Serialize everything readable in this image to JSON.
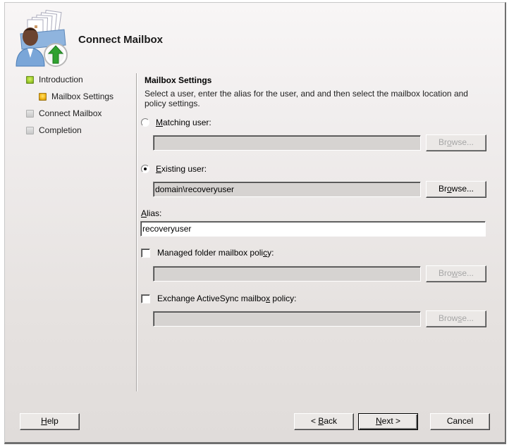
{
  "header": {
    "icon": "connect-mailbox-icon",
    "title": "Connect Mailbox"
  },
  "nav": {
    "items": [
      {
        "label": "Introduction",
        "status": "completed",
        "color": "#9fcb2a"
      },
      {
        "label": "Mailbox Settings",
        "status": "current",
        "color": "#f2b415"
      },
      {
        "label": "Connect Mailbox",
        "status": "pending",
        "color": "#c8c8c8"
      },
      {
        "label": "Completion",
        "status": "pending",
        "color": "#c8c8c8"
      }
    ]
  },
  "main": {
    "section_title": "Mailbox Settings",
    "description": "Select a user, enter the alias for the user, and and then select the mailbox location and policy settings.",
    "matching_user": {
      "label_accel": "M",
      "label_rest": "atching user:",
      "selected": false,
      "value": "",
      "browse_label_pre": "Br",
      "browse_label_accel": "o",
      "browse_label_post": "wse...",
      "browse_enabled": false
    },
    "existing_user": {
      "label_accel": "E",
      "label_rest": "xisting user:",
      "selected": true,
      "value": "domain\\recoveryuser",
      "browse_label_pre": "Br",
      "browse_label_accel": "o",
      "browse_label_post": "wse...",
      "browse_enabled": true
    },
    "alias": {
      "label_accel": "A",
      "label_rest": "lias:",
      "value": "recoveryuser"
    },
    "managed_folder_policy": {
      "label_pre": "Managed folder mailbox poli",
      "label_accel": "c",
      "label_post": "y:",
      "checked": false,
      "value": "",
      "browse_label_pre": "Bro",
      "browse_label_accel": "w",
      "browse_label_post": "se...",
      "browse_enabled": false
    },
    "activesync_policy": {
      "label_pre": "Exchange ActiveSync mailbo",
      "label_accel": "x",
      "label_post": " policy:",
      "checked": false,
      "value": "",
      "browse_label_pre": "Brow",
      "browse_label_accel": "s",
      "browse_label_post": "e...",
      "browse_enabled": false
    }
  },
  "footer": {
    "help": {
      "accel": "H",
      "rest": "elp"
    },
    "back": {
      "pre": "< ",
      "accel": "B",
      "rest": "ack"
    },
    "next": {
      "accel": "N",
      "rest": "ext >"
    },
    "cancel": "Cancel"
  }
}
